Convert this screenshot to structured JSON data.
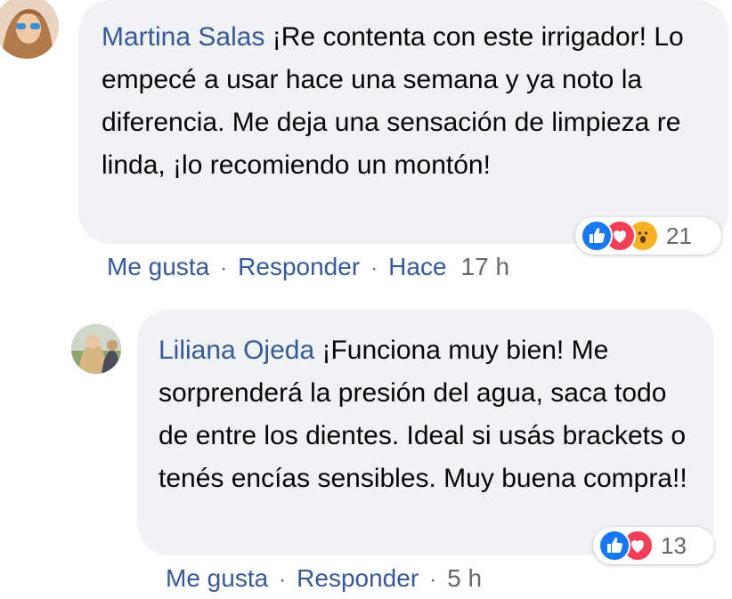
{
  "comments": [
    {
      "author": "Martina Salas",
      "text": "¡Re contenta con este irrigador! Lo empecé a usar hace una semana y ya noto la diferencia. Me deja una sensación de limpieza re linda, ¡lo recomiendo un montón!",
      "reactions": {
        "icons": [
          "like-icon",
          "love-icon",
          "wow-icon"
        ],
        "count": "21"
      },
      "actions": {
        "like": "Me gusta",
        "reply": "Responder",
        "time_prefix": "Hace",
        "time": "17 h",
        "separator": "·"
      }
    },
    {
      "author": "Liliana Ojeda",
      "text": "¡Funciona muy bien! Me sorprenderá la presión del agua, saca todo de entre los dientes. Ideal si usás brackets o tenés encías sensibles. Muy buena compra!!",
      "reactions": {
        "icons": [
          "like-icon",
          "love-icon"
        ],
        "count": "13"
      },
      "actions": {
        "like": "Me gusta",
        "reply": "Responder",
        "time": "5 h",
        "separator": "·"
      }
    }
  ],
  "colors": {
    "link": "#385898",
    "bubble": "#f0f2f5",
    "like": "#1877f2",
    "love": "#f33e58",
    "wow": "#f7b125"
  }
}
